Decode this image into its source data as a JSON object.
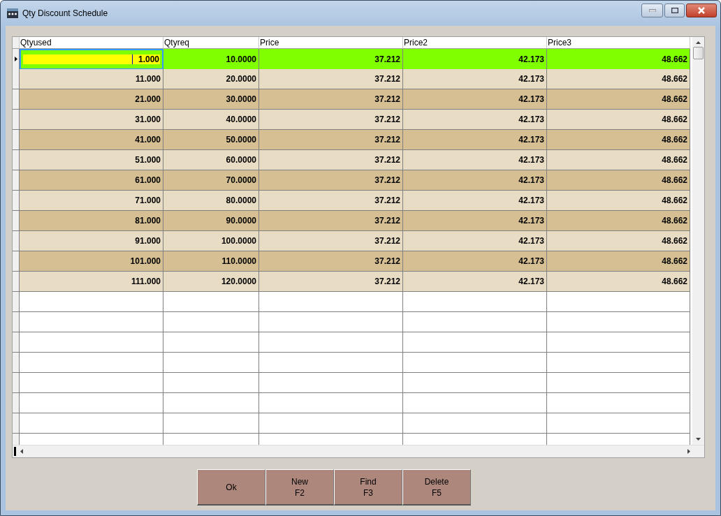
{
  "window": {
    "title": "Qty Discount Schedule"
  },
  "table": {
    "columns": [
      "Qtyused",
      "Qtyreq",
      "Price",
      "Price2",
      "Price3"
    ],
    "rows": [
      {
        "selected": true,
        "editing": true,
        "cells": [
          "1.000",
          "10.0000",
          "37.212",
          "42.173",
          "48.662"
        ]
      },
      {
        "selected": false,
        "editing": false,
        "cells": [
          "11.000",
          "20.0000",
          "37.212",
          "42.173",
          "48.662"
        ]
      },
      {
        "selected": false,
        "editing": false,
        "cells": [
          "21.000",
          "30.0000",
          "37.212",
          "42.173",
          "48.662"
        ]
      },
      {
        "selected": false,
        "editing": false,
        "cells": [
          "31.000",
          "40.0000",
          "37.212",
          "42.173",
          "48.662"
        ]
      },
      {
        "selected": false,
        "editing": false,
        "cells": [
          "41.000",
          "50.0000",
          "37.212",
          "42.173",
          "48.662"
        ]
      },
      {
        "selected": false,
        "editing": false,
        "cells": [
          "51.000",
          "60.0000",
          "37.212",
          "42.173",
          "48.662"
        ]
      },
      {
        "selected": false,
        "editing": false,
        "cells": [
          "61.000",
          "70.0000",
          "37.212",
          "42.173",
          "48.662"
        ]
      },
      {
        "selected": false,
        "editing": false,
        "cells": [
          "71.000",
          "80.0000",
          "37.212",
          "42.173",
          "48.662"
        ]
      },
      {
        "selected": false,
        "editing": false,
        "cells": [
          "81.000",
          "90.0000",
          "37.212",
          "42.173",
          "48.662"
        ]
      },
      {
        "selected": false,
        "editing": false,
        "cells": [
          "91.000",
          "100.0000",
          "37.212",
          "42.173",
          "48.662"
        ]
      },
      {
        "selected": false,
        "editing": false,
        "cells": [
          "101.000",
          "110.0000",
          "37.212",
          "42.173",
          "48.662"
        ]
      },
      {
        "selected": false,
        "editing": false,
        "cells": [
          "111.000",
          "120.0000",
          "37.212",
          "42.173",
          "48.662"
        ]
      }
    ]
  },
  "buttons": [
    {
      "lines": [
        "Ok"
      ]
    },
    {
      "lines": [
        "New",
        "F2"
      ]
    },
    {
      "lines": [
        "Find",
        "F3"
      ]
    },
    {
      "lines": [
        "Delete",
        "F5"
      ]
    }
  ]
}
